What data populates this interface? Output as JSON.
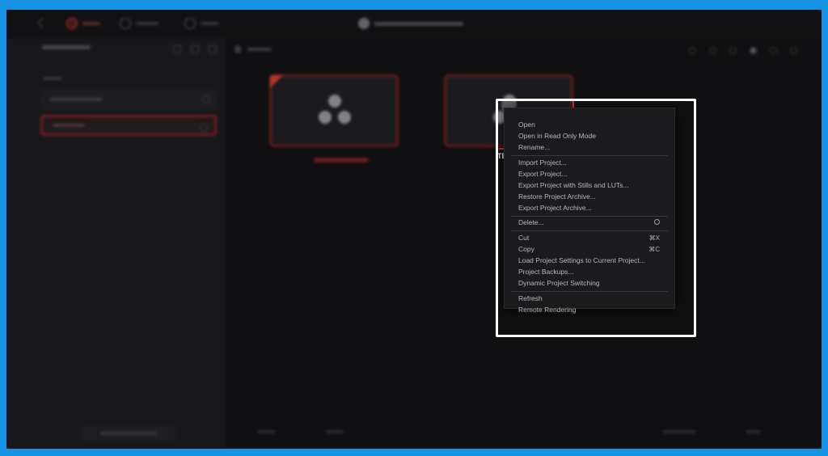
{
  "context_menu": {
    "items": [
      {
        "label": "Open",
        "shortcut": ""
      },
      {
        "label": "Open in Read Only Mode",
        "shortcut": ""
      },
      {
        "label": "Rename...",
        "shortcut": ""
      },
      {
        "label": "Import Project...",
        "shortcut": ""
      },
      {
        "label": "Export Project...",
        "shortcut": ""
      },
      {
        "label": "Export Project with Stills and LUTs...",
        "shortcut": ""
      },
      {
        "label": "Restore Project Archive...",
        "shortcut": ""
      },
      {
        "label": "Export Project Archive...",
        "shortcut": ""
      },
      {
        "label": "Delete...",
        "shortcut_icon": "delete-key-icon"
      },
      {
        "label": "Cut",
        "shortcut": "⌘X"
      },
      {
        "label": "Copy",
        "shortcut": "⌘C"
      },
      {
        "label": "Load Project Settings to Current Project...",
        "shortcut": ""
      },
      {
        "label": "Project Backups...",
        "shortcut": ""
      },
      {
        "label": "Dynamic Project Switching",
        "shortcut": ""
      },
      {
        "label": "Refresh",
        "shortcut": ""
      },
      {
        "label": "Remote Rendering",
        "shortcut": ""
      }
    ]
  },
  "peek_text": "TE",
  "colors": {
    "frame_border": "#1793e6",
    "accent_red": "#c0392b",
    "highlight_box": "#ffffff",
    "menu_bg": "#1b1b1d"
  },
  "icons": {
    "app_logo": "davinci-resolve-logo-icon",
    "delete_shortcut": "delete-key-icon"
  }
}
